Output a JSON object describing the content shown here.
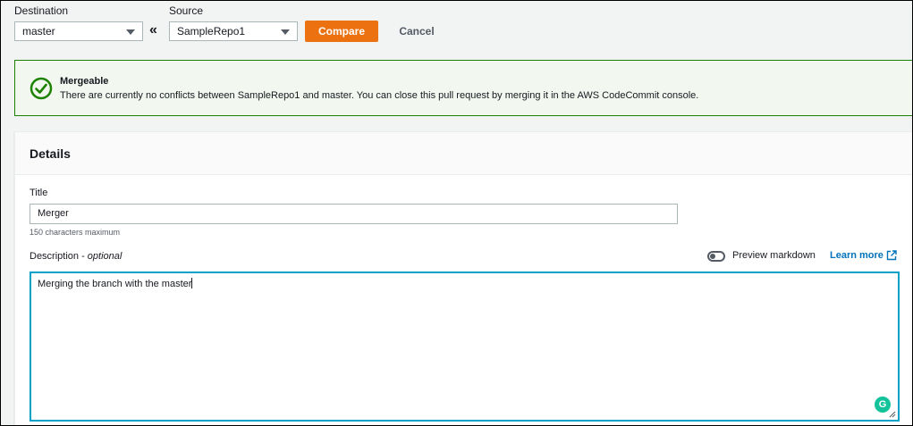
{
  "compare_bar": {
    "destination_label": "Destination",
    "destination_value": "master",
    "source_label": "Source",
    "source_value": "SampleRepo1",
    "swap_symbol": "«",
    "compare_label": "Compare",
    "cancel_label": "Cancel"
  },
  "alert": {
    "icon": "check-circle-icon",
    "title": "Mergeable",
    "message": "There are currently no conflicts between SampleRepo1 and master. You can close this pull request by merging it in the AWS CodeCommit console."
  },
  "details": {
    "heading": "Details",
    "title_label": "Title",
    "title_value": "Merger",
    "title_hint": "150 characters maximum",
    "description_label": "Description - ",
    "description_optional": "optional",
    "preview_label": "Preview markdown",
    "learn_more_label": "Learn more",
    "description_value": "Merging the branch with the master",
    "grammarly_label": "G"
  },
  "colors": {
    "primary": "#ec7211",
    "success": "#1d8102",
    "link": "#0073bb",
    "focus": "#00a1c9"
  }
}
